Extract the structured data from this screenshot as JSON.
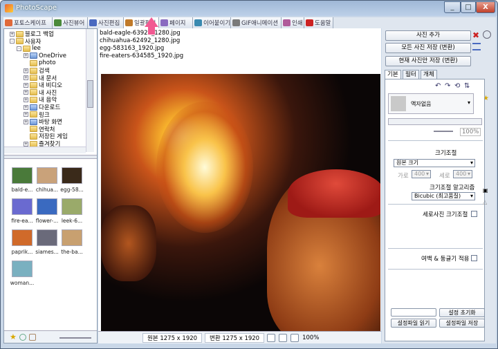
{
  "window": {
    "title": "PhotoScape",
    "minimize": "_",
    "maximize": "□",
    "close": "X"
  },
  "tabs": [
    {
      "label": "포토스케이프",
      "color": "#e06a3a"
    },
    {
      "label": "사진뷰어",
      "color": "#4a8a3a"
    },
    {
      "label": "사진편집",
      "color": "#4a6ac0"
    },
    {
      "label": "일괄편집",
      "color": "#c07a2a"
    },
    {
      "label": "페이지",
      "color": "#8a6ac0"
    },
    {
      "label": "이어붙이기",
      "color": "#3a8ab0"
    },
    {
      "label": "GIF애니메이션",
      "color": "#7a7a7a"
    },
    {
      "label": "인쇄",
      "color": "#b05a9a"
    },
    {
      "label": "도움말",
      "color": "#cc2222"
    }
  ],
  "active_tab": 3,
  "tree": [
    {
      "label": "블로그 백업",
      "indent": 1,
      "exp": "+",
      "folder": "yellow"
    },
    {
      "label": "사용자",
      "indent": 1,
      "exp": "-",
      "folder": "yellow"
    },
    {
      "label": "lee",
      "indent": 2,
      "exp": "-",
      "folder": "yellow"
    },
    {
      "label": "OneDrive",
      "indent": 3,
      "exp": "+",
      "folder": "blue"
    },
    {
      "label": "photo",
      "indent": 3,
      "exp": "",
      "folder": "yellow"
    },
    {
      "label": "검색",
      "indent": 3,
      "exp": "+",
      "folder": "yellow"
    },
    {
      "label": "내 문서",
      "indent": 3,
      "exp": "+",
      "folder": "yellow"
    },
    {
      "label": "내 비디오",
      "indent": 3,
      "exp": "+",
      "folder": "yellow"
    },
    {
      "label": "내 사진",
      "indent": 3,
      "exp": "+",
      "folder": "yellow"
    },
    {
      "label": "내 음악",
      "indent": 3,
      "exp": "+",
      "folder": "yellow"
    },
    {
      "label": "다운로드",
      "indent": 3,
      "exp": "+",
      "folder": "blue"
    },
    {
      "label": "링크",
      "indent": 3,
      "exp": "+",
      "folder": "yellow"
    },
    {
      "label": "바탕 화면",
      "indent": 3,
      "exp": "+",
      "folder": "blue"
    },
    {
      "label": "연락처",
      "indent": 3,
      "exp": "",
      "folder": "yellow"
    },
    {
      "label": "저장된 게임",
      "indent": 3,
      "exp": "",
      "folder": "yellow"
    },
    {
      "label": "즐겨찾기",
      "indent": 3,
      "exp": "+",
      "folder": "yellow"
    }
  ],
  "thumbnails": [
    {
      "label": "bald-e...",
      "color": "#4a7a3a"
    },
    {
      "label": "chihua...",
      "color": "#c9a27a"
    },
    {
      "label": "egg-58...",
      "color": "#3a2a1a"
    },
    {
      "label": "fire-ea...",
      "color": "#6a6ad0"
    },
    {
      "label": "flower-...",
      "color": "#3a6ac0"
    },
    {
      "label": "leek-6...",
      "color": "#9aaa6a"
    },
    {
      "label": "paprik...",
      "color": "#d06a2a"
    },
    {
      "label": "siames...",
      "color": "#6a6a7a"
    },
    {
      "label": "the-ba...",
      "color": "#c8a070"
    },
    {
      "label": "woman...",
      "color": "#7ab0c0"
    }
  ],
  "files": [
    "bald-eagle-63927_1280.jpg",
    "chihuahua-62492_1280.jpg",
    "egg-583163_1920.jpg",
    "fire-eaters-634585_1920.jpg"
  ],
  "status": {
    "original": "원본 1275 x 1920",
    "converted": "변환 1275 x 1920",
    "zoom": "100%"
  },
  "right": {
    "add_photo": "사진 추가",
    "save_all": "모든 사진 저장 (변환)",
    "save_current": "현재 사진만 저장 (변환)",
    "tabs": [
      "기본",
      "필터",
      "개체"
    ],
    "frame_none": "액자없음",
    "frame_zoom": "100%",
    "resize_title": "크기조절",
    "resize_option": "원본 크기",
    "width_label": "가로",
    "width_value": "400",
    "height_label": "세로",
    "height_value": "400",
    "algo_title": "크기조절 알고리즘",
    "algo_option": "Bicubic (최고품질)",
    "portrait_resize": "세로사진 크기조절",
    "margin_round": "여백 & 둥글기 적용",
    "reset_settings": "설정 초기화",
    "load_settings": "설정파일 읽기",
    "save_settings": "설정파일 저장"
  }
}
